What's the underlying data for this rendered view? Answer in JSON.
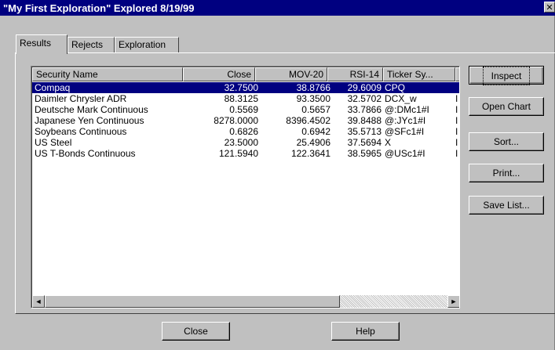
{
  "window": {
    "title": "\"My First Exploration\" Explored 8/19/99",
    "close_glyph": "✕"
  },
  "tabs": [
    {
      "label": "Results",
      "active": true
    },
    {
      "label": "Rejects",
      "active": false
    },
    {
      "label": "Exploration",
      "active": false
    }
  ],
  "table": {
    "columns": [
      "Security Name",
      "Close",
      "MOV-20",
      "RSI-14",
      "Ticker Sy..."
    ],
    "rows": [
      {
        "name": "Compaq",
        "close": "32.7500",
        "mov20": "38.8766",
        "rsi14": "29.6009",
        "ticker": "CPQ",
        "extra": "",
        "selected": true
      },
      {
        "name": "Daimler Chrysler ADR",
        "close": "88.3125",
        "mov20": "93.3500",
        "rsi14": "32.5702",
        "ticker": "DCX_w",
        "extra": "I",
        "selected": false
      },
      {
        "name": "Deutsche Mark Continuous",
        "close": "0.5569",
        "mov20": "0.5657",
        "rsi14": "33.7866",
        "ticker": "@:DMc1#I",
        "extra": "I",
        "selected": false
      },
      {
        "name": "Japanese Yen Continuous",
        "close": "8278.0000",
        "mov20": "8396.4502",
        "rsi14": "39.8488",
        "ticker": "@:JYc1#I",
        "extra": "I",
        "selected": false
      },
      {
        "name": "Soybeans Continuous",
        "close": "0.6826",
        "mov20": "0.6942",
        "rsi14": "35.5713",
        "ticker": "@SFc1#I",
        "extra": "I",
        "selected": false
      },
      {
        "name": "US Steel",
        "close": "23.5000",
        "mov20": "25.4906",
        "rsi14": "37.5694",
        "ticker": "X",
        "extra": "I",
        "selected": false
      },
      {
        "name": "US T-Bonds Continuous",
        "close": "121.5940",
        "mov20": "122.3641",
        "rsi14": "38.5965",
        "ticker": "@USc1#I",
        "extra": "I",
        "selected": false
      }
    ],
    "scroll_left_glyph": "◄",
    "scroll_right_glyph": "►"
  },
  "side_buttons": {
    "inspect": "Inspect",
    "open_chart": "Open Chart",
    "sort": "Sort...",
    "print": "Print...",
    "save_list": "Save List..."
  },
  "bottom_buttons": {
    "close": "Close",
    "help": "Help"
  },
  "colors": {
    "titlebar": "#000080",
    "selection": "#000080",
    "face": "#c0c0c0"
  }
}
